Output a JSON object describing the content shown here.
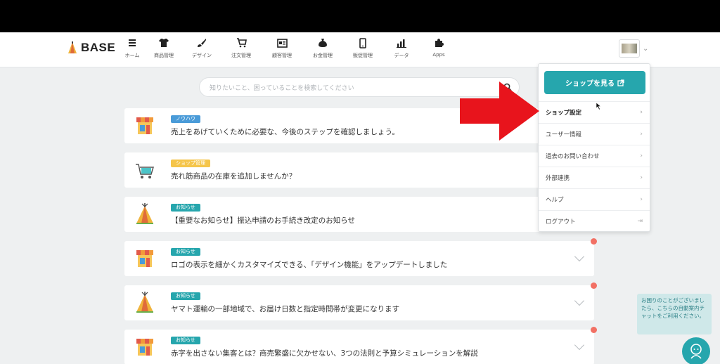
{
  "logo": {
    "text": "BASE"
  },
  "nav": [
    {
      "label": "ホーム",
      "icon": "menu-icon"
    },
    {
      "label": "商品管理",
      "icon": "shirt-icon"
    },
    {
      "label": "デザイン",
      "icon": "brush-icon"
    },
    {
      "label": "注文管理",
      "icon": "cart-icon"
    },
    {
      "label": "顧客管理",
      "icon": "id-card-icon"
    },
    {
      "label": "お金管理",
      "icon": "money-bag-icon"
    },
    {
      "label": "販促管理",
      "icon": "smartphone-icon"
    },
    {
      "label": "データ",
      "icon": "bar-chart-icon"
    },
    {
      "label": "Apps",
      "icon": "puzzle-icon"
    }
  ],
  "search": {
    "placeholder": "知りたいこと、困っていることを検索してください"
  },
  "cards": [
    {
      "badge": "ノウハウ",
      "badge_color": "#4a9bd8",
      "text": "売上をあげていくために必要な、今後のステップを確認しましょう。",
      "icon": "shop-icon",
      "dot": false
    },
    {
      "badge": "ショップ管理",
      "badge_color": "#f5c54a",
      "text": "売れ筋商品の在庫を追加しませんか？",
      "icon": "cart-icon",
      "dot": false
    },
    {
      "badge": "お知らせ",
      "badge_color": "#26a6ad",
      "text": "【重要なお知らせ】振込申請のお手続き改定のお知らせ",
      "icon": "tent-icon",
      "dot": false
    },
    {
      "badge": "お知らせ",
      "badge_color": "#26a6ad",
      "text": "ロゴの表示を細かくカスタマイズできる、「デザイン機能」をアップデートしました",
      "icon": "shop-icon",
      "dot": true
    },
    {
      "badge": "お知らせ",
      "badge_color": "#26a6ad",
      "text": "ヤマト運輸の一部地域で、お届け日数と指定時間帯が変更になります",
      "icon": "tent-icon",
      "dot": true
    },
    {
      "badge": "お知らせ",
      "badge_color": "#26a6ad",
      "text": "赤字を出さない集客とは？商売繁盛に欠かせない、3つの法則と予算シミュレーションを解説",
      "icon": "shop-icon",
      "dot": true
    }
  ],
  "dropdown": {
    "shop_button": "ショップを見る",
    "items": [
      "ショップ設定",
      "ユーザー情報",
      "過去のお問い合わせ",
      "外部連携",
      "ヘルプ",
      "ログアウト"
    ]
  },
  "help": {
    "text": "お困りのことがございましたら、こちらの自動案内チャットをご利用ください。"
  },
  "colors": {
    "accent": "#26a6ad",
    "arrow": "#e8141c",
    "dot": "#f27064"
  }
}
